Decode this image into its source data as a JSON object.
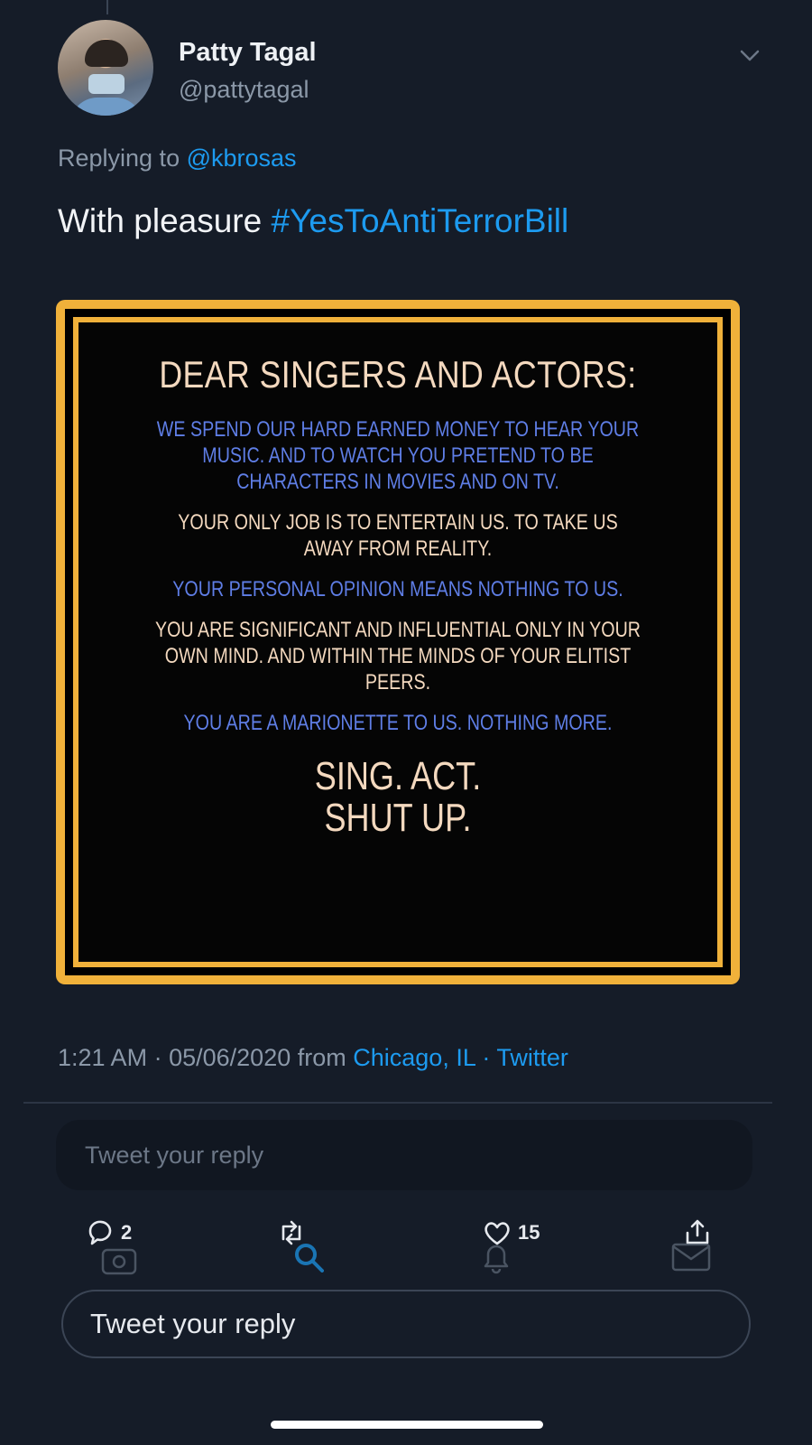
{
  "tweet": {
    "author_name": "Patty Tagal",
    "author_handle": "@pattytagal",
    "replying_prefix": "Replying to",
    "replying_mention": "@kbrosas",
    "text_prefix": "With pleasure",
    "hashtag": "#YesToAntiTerrorBill",
    "time": "1:21 AM",
    "date": "05/06/2020",
    "from_label": "from",
    "location": "Chicago, IL",
    "source": "Twitter"
  },
  "image": {
    "title": "DEAR SINGERS AND ACTORS:",
    "paragraphs": [
      {
        "text": "WE SPEND OUR HARD EARNED MONEY TO HEAR YOUR MUSIC. AND TO WATCH YOU PRETEND TO BE CHARACTERS IN MOVIES AND ON TV.",
        "color": "blue"
      },
      {
        "text": "YOUR ONLY JOB IS TO ENTERTAIN US. TO TAKE US AWAY FROM REALITY.",
        "color": "cream"
      },
      {
        "text": "YOUR PERSONAL OPINION MEANS NOTHING TO US.",
        "color": "blue"
      },
      {
        "text": "YOU ARE SIGNIFICANT AND INFLUENTIAL ONLY IN YOUR OWN MIND. AND WITHIN THE MINDS OF YOUR ELITIST PEERS.",
        "color": "cream"
      },
      {
        "text": "YOU ARE A MARIONETTE TO US. NOTHING MORE.",
        "color": "blue"
      }
    ],
    "closing_line1": "SING. ACT.",
    "closing_line2": "SHUT UP.",
    "colors": {
      "frame": "#f0b13a",
      "blue_text": "#5f7ee6",
      "cream_text": "#f4d9bf"
    }
  },
  "reply_placeholder_top": "Tweet your reply",
  "actions": {
    "reply_count": "2",
    "like_count": "15"
  },
  "reply_placeholder_bottom": "Tweet your reply",
  "theme": {
    "background": "#151c28",
    "link": "#1d9bf0",
    "muted": "#8b98a8"
  }
}
